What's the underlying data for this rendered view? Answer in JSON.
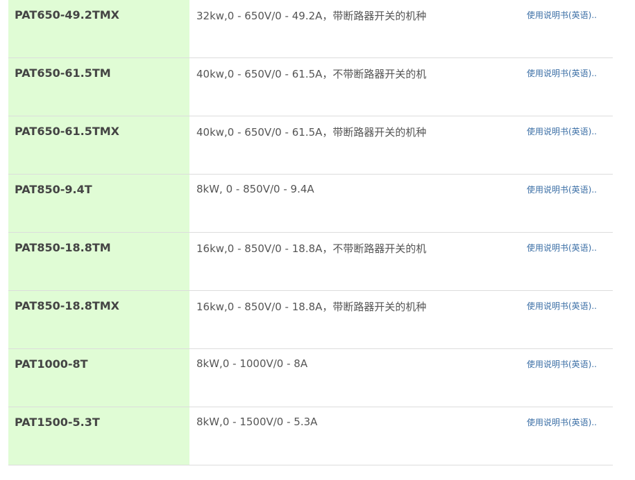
{
  "products": [
    {
      "model": "PAT650-49.2TMX",
      "spec": "32kw,0 - 650V/0 - 49.2A，带断路器开关的机种",
      "link": "使用说明书(英语).."
    },
    {
      "model": "PAT650-61.5TM",
      "spec": "40kw,0 - 650V/0 - 61.5A，不带断路器开关的机",
      "link": "使用说明书(英语).."
    },
    {
      "model": "PAT650-61.5TMX",
      "spec": "40kw,0 - 650V/0 - 61.5A，带断路器开关的机种",
      "link": "使用说明书(英语).."
    },
    {
      "model": "PAT850-9.4T",
      "spec": "8kW, 0 - 850V/0 - 9.4A",
      "link": "使用说明书(英语).."
    },
    {
      "model": "PAT850-18.8TM",
      "spec": "16kw,0 - 850V/0 - 18.8A，不带断路器开关的机",
      "link": "使用说明书(英语).."
    },
    {
      "model": "PAT850-18.8TMX",
      "spec": "16kw,0 - 850V/0 - 18.8A，带断路器开关的机种",
      "link": "使用说明书(英语).."
    },
    {
      "model": "PAT1000-8T",
      "spec": "8kW,0 - 1000V/0 - 8A",
      "link": "使用说明书(英语).."
    },
    {
      "model": "PAT1500-5.3T",
      "spec": "8kW,0 - 1500V/0 - 5.3A",
      "link": "使用说明书(英语).."
    }
  ],
  "colors": {
    "model_column_bg": "#e0fcd5",
    "link": "#3a6ea5",
    "row_divider": "#dcdcdc"
  }
}
